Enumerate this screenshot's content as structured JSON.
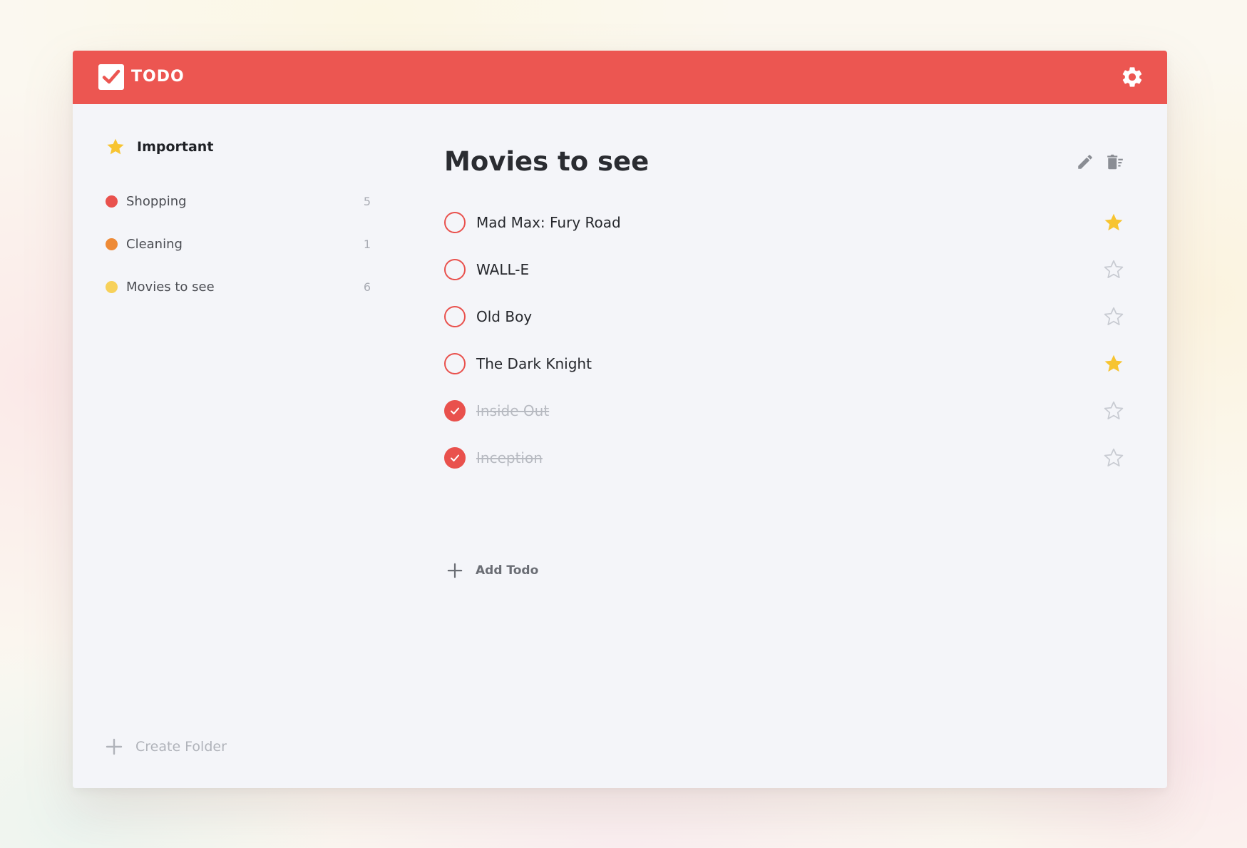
{
  "app": {
    "title": "TODO",
    "accent_color": "#ec5651",
    "logo_icon": "checkmark-icon",
    "settings_icon": "gear-icon"
  },
  "sidebar": {
    "important": {
      "label": "Important",
      "icon": "star-icon",
      "color": "#f7c431"
    },
    "folders": [
      {
        "name": "Shopping",
        "count": "5",
        "color": "#e9514d"
      },
      {
        "name": "Cleaning",
        "count": "1",
        "color": "#ee8a36"
      },
      {
        "name": "Movies to see",
        "count": "6",
        "color": "#f7d15a"
      }
    ],
    "create_folder_label": "Create Folder"
  },
  "main": {
    "list_title": "Movies to see",
    "actions": [
      {
        "icon": "pencil-icon"
      },
      {
        "icon": "trash-icon"
      }
    ],
    "todos": [
      {
        "text": "Mad Max: Fury Road",
        "done": false,
        "starred": true
      },
      {
        "text": "WALL-E",
        "done": false,
        "starred": false
      },
      {
        "text": "Old Boy",
        "done": false,
        "starred": false
      },
      {
        "text": "The Dark Knight",
        "done": false,
        "starred": true
      },
      {
        "text": "Inside Out",
        "done": true,
        "starred": false
      },
      {
        "text": "Inception",
        "done": true,
        "starred": false
      }
    ],
    "add_todo_label": "Add Todo"
  }
}
